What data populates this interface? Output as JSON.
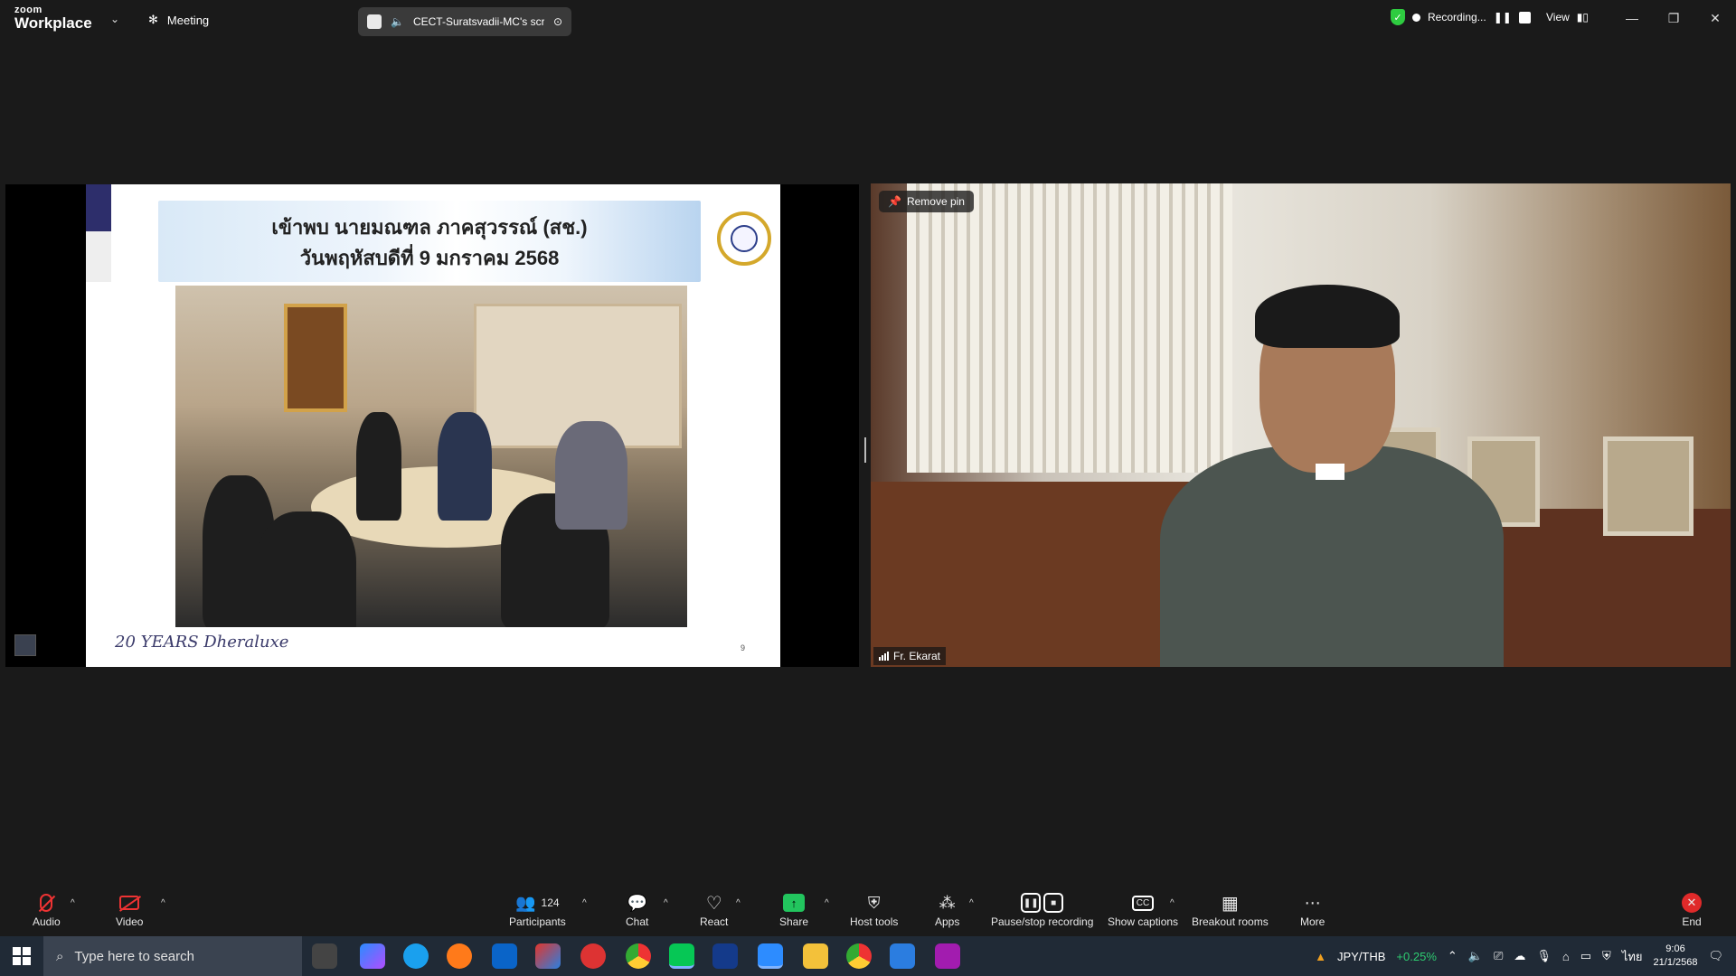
{
  "topbar": {
    "logo_top": "zoom",
    "logo_bottom": "Workplace",
    "meeting_label": "Meeting",
    "share_title": "CECT-Suratsvadii-MC's scre",
    "recording_label": "Recording...",
    "view_label": "View"
  },
  "slide": {
    "title_line1": "เข้าพบ นายมณฑล ภาคสุวรรณ์ (สช.)",
    "title_line2": "วันพฤหัสบดีที่ 9 มกราคม 2568",
    "footer": "20 YEARS Dheraluxe",
    "page_number": "9"
  },
  "video": {
    "pin_label": "Remove pin",
    "participant_name": "Fr. Ekarat"
  },
  "toolbar": {
    "audio": "Audio",
    "video": "Video",
    "participants": "Participants",
    "participants_count": "124",
    "chat": "Chat",
    "react": "React",
    "share": "Share",
    "host_tools": "Host tools",
    "apps": "Apps",
    "pause_stop": "Pause/stop recording",
    "captions": "Show captions",
    "breakout": "Breakout rooms",
    "more": "More",
    "end": "End"
  },
  "taskbar": {
    "search_placeholder": "Type here to search",
    "ticker_pair": "JPY/THB",
    "ticker_change": "+0.25%",
    "lang": "ไทย",
    "time": "9:06",
    "date": "21/1/2568"
  },
  "colors": {
    "accent_green": "#22c55e",
    "end_red": "#e02a2a",
    "ticker_green": "#2ecc71"
  }
}
